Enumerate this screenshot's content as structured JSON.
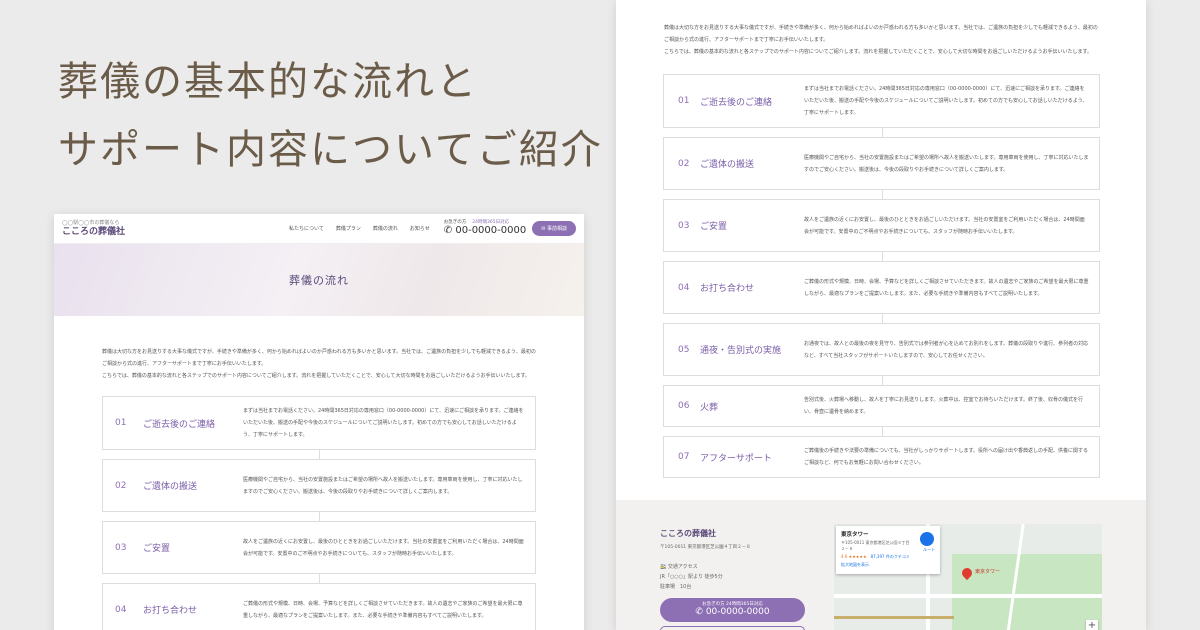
{
  "hero": {
    "line1": "葬儀の基本的な流れと",
    "line2": "サポート内容についてご紹介"
  },
  "site": {
    "tagline": "◯◯駅◯◯市の葬儀なら",
    "name": "こころの葬儀社",
    "nav": [
      "私たちについて",
      "葬儀プラン",
      "葬儀の流れ",
      "お知らせ"
    ],
    "phone_label": "お急ぎの方",
    "phone_hours": "24時間365日対応",
    "phone": "00-0000-0000",
    "consult_button": "事前相談",
    "page_title": "葬儀の流れ"
  },
  "intro": {
    "p1": "葬儀は大切な方をお見送りする大事な儀式ですが、手続きや準備が多く、何から始めればよいのか戸惑われる方も多いかと思います。当社では、ご遺族の負担を少しでも軽減できるよう、最初のご相談から式の進行、アフターサポートまで丁寧にお手伝いいたします。",
    "p2": "こちらでは、葬儀の基本的な流れと各ステップでのサポート内容についてご紹介します。流れを把握していただくことで、安心して大切な時間をお過ごしいただけるようお手伝いいたします。"
  },
  "steps": [
    {
      "num": "01",
      "title": "ご逝去後のご連絡",
      "desc": "まずは当社までお電話ください。24時間365日対応の専用窓口（00-0000-0000）にて、迅速にご相談を承ります。ご連絡をいただいた後、搬送の手配や今後のスケジュールについてご説明いたします。初めての方でも安心してお話しいただけるよう、丁寧にサポートします。"
    },
    {
      "num": "02",
      "title": "ご遺体の搬送",
      "desc": "医療機関やご自宅から、当社の安置施設またはご希望の場所へ故人を搬送いたします。専用車両を使用し、丁寧に対応いたしますのでご安心ください。搬送後は、今後の段取りやお手続きについて詳しくご案内します。"
    },
    {
      "num": "03",
      "title": "ご安置",
      "desc": "故人をご遺族の近くにお安置し、最後のひとときをお過ごしいただけます。当社の安置室をご利用いただく場合は、24時間面会が可能です。安置中のご不明点やお手続きについても、スタッフが随時お手伝いいたします。"
    },
    {
      "num": "04",
      "title": "お打ち合わせ",
      "desc": "ご葬儀の形式や規模、日時、会場、予算などを詳しくご相談させていただきます。故人の遺志やご家族のご希望を最大限に尊重しながら、最適なプランをご提案いたします。また、必要な手続きや準備内容もすべてご説明いたします。"
    },
    {
      "num": "05",
      "title": "通夜・告別式の実施",
      "desc": "お通夜では、故人との最後の夜を見守り、告別式では参列者が心を込めてお別れをします。葬儀の段取りや進行、参列者の対応など、すべて当社スタッフがサポートいたしますので、安心してお任せください。"
    },
    {
      "num": "06",
      "title": "火葬",
      "desc": "告別式後、火葬場へ移動し、故人を丁寧にお見送りします。火葬中は、控室でお待ちいただけます。終了後、収骨の儀式を行い、骨壺に遺骨を納めます。"
    },
    {
      "num": "07",
      "title": "アフターサポート",
      "desc": "ご葬儀後の手続きや法要の準備についても、当社がしっかりサポートします。役所への届け出や香典返しの手配、供養に関するご相談など、何でもお気軽にお問い合わせください。"
    }
  ],
  "footer": {
    "name": "こころの葬儀社",
    "address": "〒105-0011 東京都港区芝公園４丁目２－８",
    "access_title": "交通アクセス",
    "access_train": "JR「○○○」駅より 徒歩5分",
    "access_parking": "駐車場　10台",
    "phone_label": "お急ぎの方",
    "phone_hours": "24時間365日対応",
    "phone": "00-0000-0000"
  },
  "map": {
    "place": "東京タワー",
    "address": "〒105-0011 東京都港区芝公園４丁目２－８",
    "rating": "4.6 ★★★★★",
    "reviews": "87,397 件のクチコミ",
    "route": "ルート",
    "enlarge": "拡大地図を表示",
    "pin_label": "東京タワー",
    "zoom_in": "+"
  }
}
